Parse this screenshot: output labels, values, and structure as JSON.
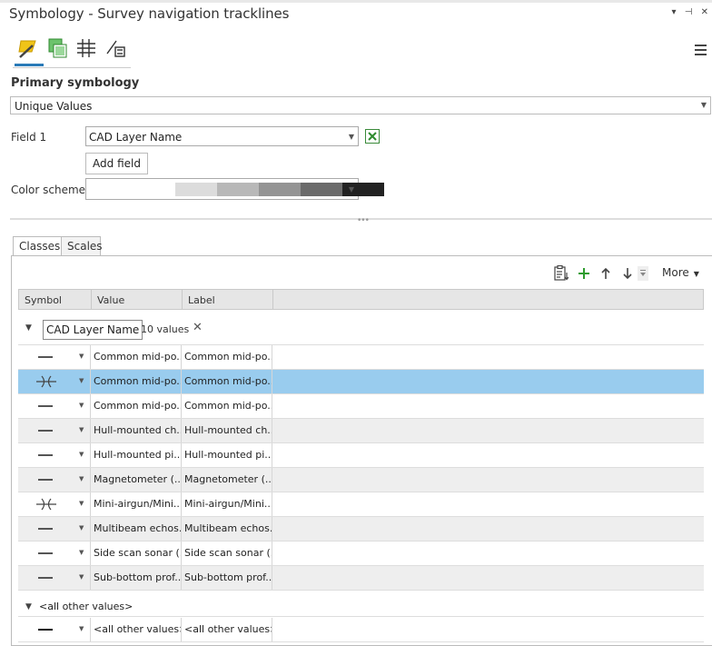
{
  "window": {
    "title": "Symbology - Survey navigation tracklines",
    "controls": [
      "▾",
      "⊣",
      "✕"
    ]
  },
  "toolbar": {
    "tools": [
      {
        "name": "primary-symbology",
        "icon": "paintbrush-icon",
        "active": true
      },
      {
        "name": "vary-symbology",
        "icon": "layers-icon"
      },
      {
        "name": "symbol-layer-drawing",
        "icon": "grid-hash-icon"
      },
      {
        "name": "symbol-properties",
        "icon": "pencil-list-icon"
      }
    ]
  },
  "primary": {
    "heading": "Primary symbology",
    "method": "Unique Values",
    "field1_label": "Field 1",
    "field1_value": "CAD Layer Name",
    "add_field_label": "Add field",
    "color_scheme_label": "Color scheme",
    "color_ramp": [
      "#ffffff",
      "#dcdcdc",
      "#b8b8b8",
      "#949494",
      "#6b6b6b",
      "#222222"
    ]
  },
  "tabs": [
    {
      "label": "Classes",
      "active": true
    },
    {
      "label": "Scales",
      "active": false
    }
  ],
  "classes_toolbar": {
    "more_label": "More",
    "add_color": "#2e9c2e"
  },
  "table": {
    "columns": [
      "Symbol",
      "Value",
      "Label"
    ],
    "group": {
      "field": "CAD Layer Name",
      "count_label": "10 values"
    },
    "rows": [
      {
        "symbol": "line",
        "value": "Common mid-po...",
        "label": "Common mid-po..."
      },
      {
        "symbol": "airgun",
        "value": "Common mid-po...",
        "label": "Common mid-po...",
        "selected": true
      },
      {
        "symbol": "line",
        "value": "Common mid-po...",
        "label": "Common mid-po..."
      },
      {
        "symbol": "line",
        "value": "Hull-mounted ch...",
        "label": "Hull-mounted ch..."
      },
      {
        "symbol": "line",
        "value": "Hull-mounted pi...",
        "label": "Hull-mounted pi..."
      },
      {
        "symbol": "line",
        "value": "Magnetometer (...",
        "label": "Magnetometer (..."
      },
      {
        "symbol": "airgun",
        "value": "Mini-airgun/Mini...",
        "label": "Mini-airgun/Mini..."
      },
      {
        "symbol": "line",
        "value": "Multibeam echos...",
        "label": "Multibeam echos..."
      },
      {
        "symbol": "line",
        "value": "Side scan sonar (...",
        "label": "Side scan sonar (..."
      },
      {
        "symbol": "line",
        "value": "Sub-bottom prof...",
        "label": "Sub-bottom prof..."
      }
    ],
    "other": {
      "header": "<all other values>",
      "value": "<all other values>",
      "label": "<all other values>"
    },
    "selected_color": "#99ccee"
  }
}
